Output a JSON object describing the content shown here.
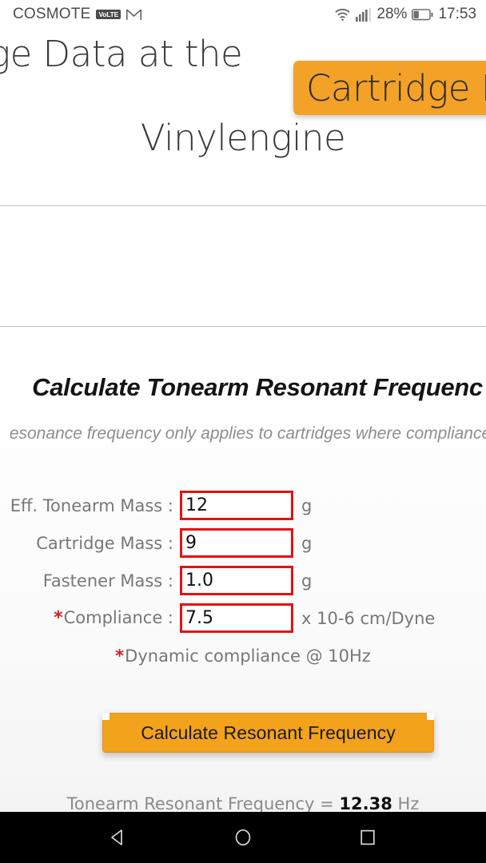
{
  "status_bar": {
    "carrier": "COSMOTE",
    "volte_badge": "VoLTE",
    "gmail_icon": "gmail-icon",
    "wifi_icon": "wifi-icon",
    "signal_icon": "signal-bars-icon",
    "battery_percent": "28%",
    "battery_icon": "battery-icon",
    "clock": "17:53"
  },
  "site_header": {
    "title_line1": "ridge Data at the",
    "title_line2": "Vinylengine",
    "highlight_tag": "Cartridge D"
  },
  "calculator": {
    "title": "Calculate Tonearm Resonant Frequenc",
    "subtitle": "esonance frequency only applies to cartridges where compliance",
    "fields": [
      {
        "label": "Eff. Tonearm Mass :",
        "required": false,
        "value": "12",
        "unit": "g"
      },
      {
        "label": "Cartridge Mass :",
        "required": false,
        "value": "9",
        "unit": "g"
      },
      {
        "label": "Fastener Mass :",
        "required": false,
        "value": "1.0",
        "unit": "g"
      },
      {
        "label": "Compliance :",
        "required": true,
        "value": "7.5",
        "unit": "x 10-6 cm/Dyne"
      }
    ],
    "note_star": "*",
    "note": "Dynamic compliance @ 10Hz",
    "button_label": "Calculate Resonant Frequency",
    "result_prefix": "Tonearm Resonant Frequency = ",
    "result_value": "12.38",
    "result_suffix": " Hz"
  },
  "nav_bar": {
    "back_label": "back-icon",
    "home_label": "home-icon",
    "recents_label": "recents-icon"
  },
  "colors": {
    "accent_orange": "#F3A227",
    "button_orange": "#F3A21B",
    "field_red": "#E51111",
    "text_dark": "#141414",
    "text_muted": "#777777"
  }
}
